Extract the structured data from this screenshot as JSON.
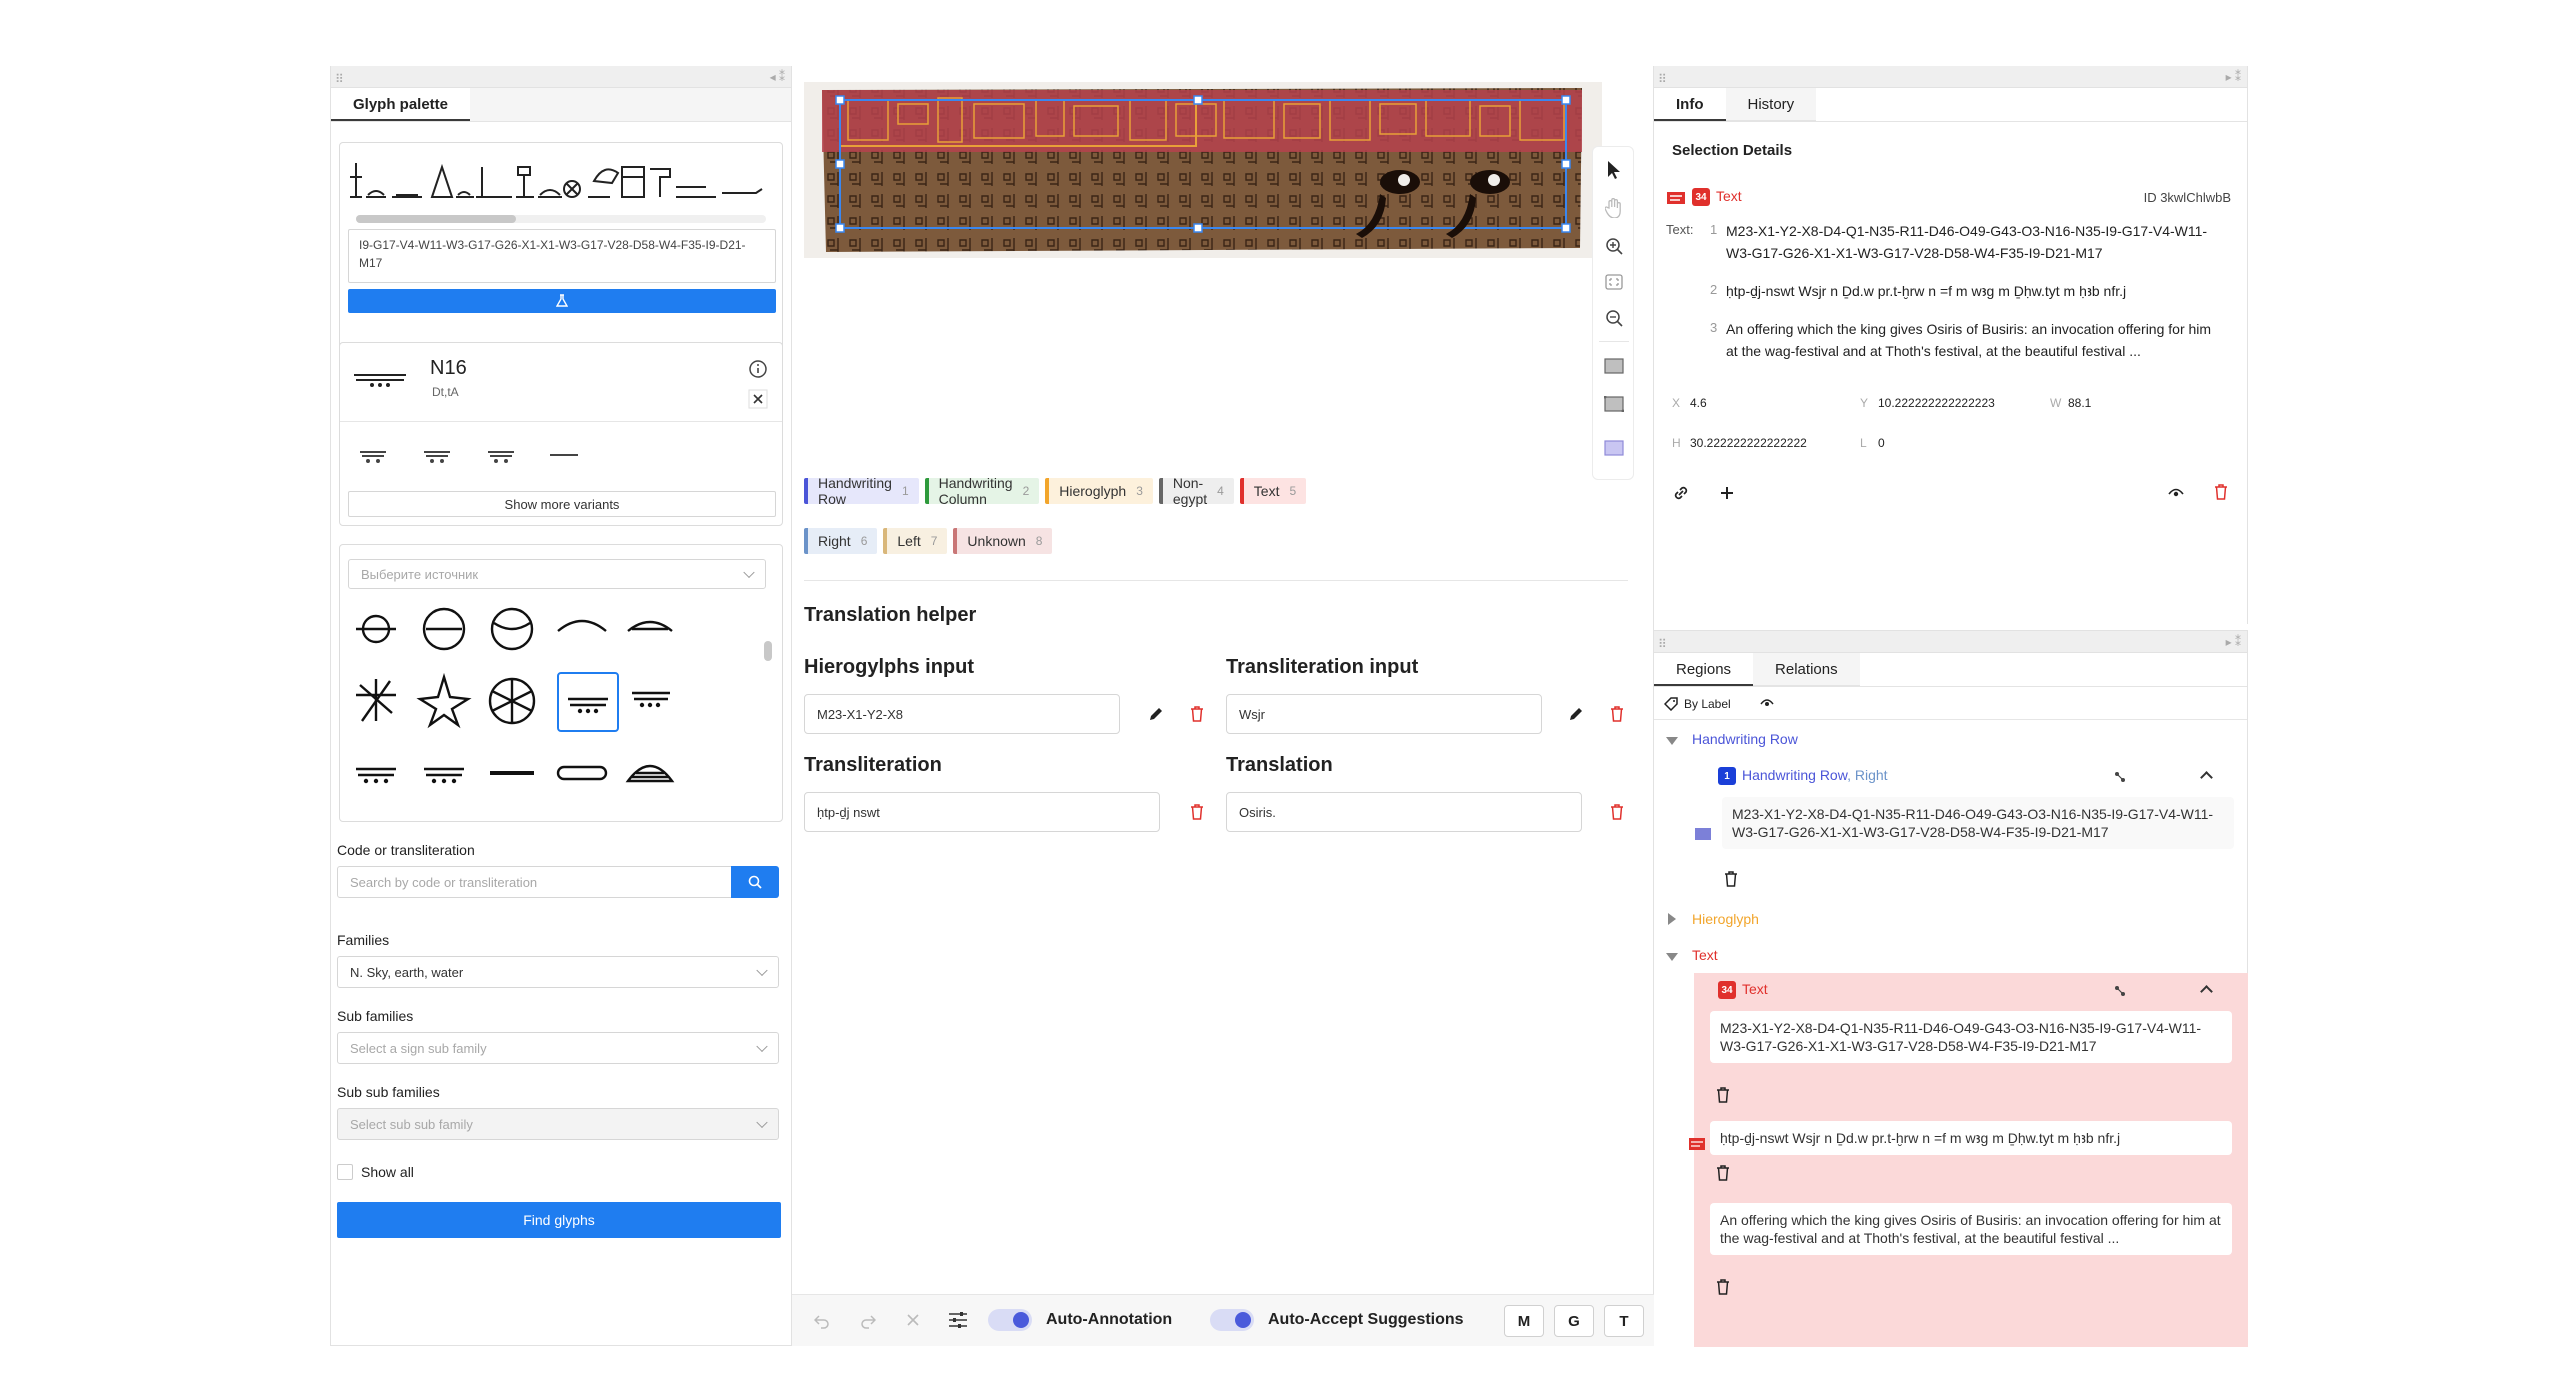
{
  "left": {
    "palette_tab": "Glyph palette",
    "code_text": "I9-G17-V4-W11-W3-G17-G26-X1-X1-W3-G17-V28-D58-W4-F35-I9-D21-M17",
    "glyph_title": "N16",
    "glyph_translit": "Dt,tA",
    "show_more": "Show more variants",
    "source_placeholder": "Выберите источник",
    "code_label": "Code or transliteration",
    "search_placeholder": "Search by code or transliteration",
    "families_label": "Families",
    "families_value": "N. Sky, earth, water",
    "subfam_label": "Sub families",
    "subfam_placeholder": "Select a sign sub family",
    "subsub_label": "Sub sub families",
    "subsub_placeholder": "Select sub sub family",
    "show_all": "Show all",
    "find_glyphs": "Find glyphs"
  },
  "center": {
    "chips_row1": [
      {
        "label": "Handwriting Row",
        "n": "1",
        "color": "#4b55d8",
        "bg": "#e6e7fb"
      },
      {
        "label": "Handwriting Column",
        "n": "2",
        "color": "#2e9a3c",
        "bg": "#e5f4e6"
      },
      {
        "label": "Hieroglyph",
        "n": "3",
        "color": "#f2a52b",
        "bg": "#fdf1dc"
      },
      {
        "label": "Non-egypt",
        "n": "4",
        "color": "#666666",
        "bg": "#eeeeee"
      },
      {
        "label": "Text",
        "n": "5",
        "color": "#e0302c",
        "bg": "#fde3e2"
      }
    ],
    "chips_row2": [
      {
        "label": "Right",
        "n": "6",
        "color": "#6b93c9",
        "bg": "#e6edf7"
      },
      {
        "label": "Left",
        "n": "7",
        "color": "#d9b77a",
        "bg": "#f8f0e1"
      },
      {
        "label": "Unknown",
        "n": "8",
        "color": "#c97777",
        "bg": "#f6e3e3"
      }
    ],
    "translation_helper": "Translation helper",
    "hiero_input_label": "Hierogylphs input",
    "hiero_input_value": "M23-X1-Y2-X8",
    "translit_input_label": "Transliteration input",
    "translit_input_value": "Wsjr",
    "translit_label": "Transliteration",
    "translit_value": "ḥtp-ḏj nswt",
    "translation_label": "Translation",
    "translation_value": "Osiris.",
    "auto_annotation": "Auto-Annotation",
    "auto_accept": "Auto-Accept Suggestions",
    "btn_m": "M",
    "btn_g": "G",
    "btn_t": "T"
  },
  "right_top": {
    "tab_info": "Info",
    "tab_history": "History",
    "selection_details": "Selection Details",
    "sel_type": "Text",
    "sel_id": "ID 3kwlChlwbB",
    "text_label": "Text:",
    "line1_no": "1",
    "line1": "M23-X1-Y2-X8-D4-Q1-N35-R11-D46-O49-G43-O3-N16-N35-I9-G17-V4-W11-W3-G17-G26-X1-X1-W3-G17-V28-D58-W4-F35-I9-D21-M17",
    "line2_no": "2",
    "line2": "ḥtp-ḏj-nswt Wsjr n Ḏd.w pr.t-ḫrw n =f m w‌ꜣg m Ḏḥw.tyt m ḥꜣb nfr.j",
    "line3_no": "3",
    "line3": "An offering which the king gives Osiris of Busiris: an invocation offering for him at the wag-festival and at Thoth's festival, at the beautiful festival ...",
    "x_label": "X",
    "x_value": "4.6",
    "y_label": "Y",
    "y_value": "10.222222222222223",
    "w_label": "W",
    "w_value": "88.1",
    "h_label": "H",
    "h_value": "30.222222222222222",
    "l_label": "L",
    "l_value": "0"
  },
  "right_bottom": {
    "tab_regions": "Regions",
    "tab_relations": "Relations",
    "by_label": "By Label",
    "group1": "Handwriting Row",
    "item1_title": "Handwriting Row",
    "item1_sub": ", Right",
    "item1_text": "M23-X1-Y2-X8-D4-Q1-N35-R11-D46-O49-G43-O3-N16-N35-I9-G17-V4-W11-W3-G17-G26-X1-X1-W3-G17-V28-D58-W4-F35-I9-D21-M17",
    "group2": "Hieroglyph",
    "group3": "Text",
    "item2_title": "Text",
    "item2_text": "M23-X1-Y2-X8-D4-Q1-N35-R11-D46-O49-G43-O3-N16-N35-I9-G17-V4-W11-W3-G17-G26-X1-X1-W3-G17-V28-D58-W4-F35-I9-D21-M17",
    "item3_text": "ḥtp-ḏj-nswt Wsjr n Ḏd.w pr.t-ḫrw n =f m wꜣg m Ḏḥw.tyt m ḥꜣb nfr.j",
    "item4_text": "An offering which the king gives Osiris of Busiris: an invocation offering for him at the wag-festival and at Thoth's festival, at the beautiful festival ..."
  },
  "colors": {
    "accent": "#1f7df0",
    "text_red": "#e0302c",
    "hw_blue": "#4b55d8",
    "hiero_orange": "#f2a52b",
    "selected_bg": "#fbd9d9"
  }
}
